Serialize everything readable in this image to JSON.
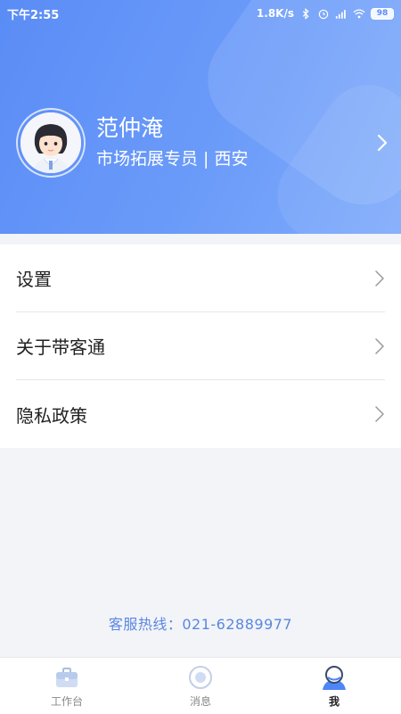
{
  "status_bar": {
    "time": "下午2:55",
    "network_speed": "1.8K/s",
    "battery": "98"
  },
  "profile": {
    "name": "范仲淹",
    "role_location": "市场拓展专员 | 西安"
  },
  "menu": {
    "items": [
      {
        "label": "设置"
      },
      {
        "label": "关于带客通"
      },
      {
        "label": "隐私政策"
      }
    ]
  },
  "footer": {
    "hotline": "客服热线：021-62889977"
  },
  "tabbar": {
    "tabs": [
      {
        "label": "工作台",
        "icon": "briefcase-icon",
        "active": false
      },
      {
        "label": "消息",
        "icon": "message-icon",
        "active": false
      },
      {
        "label": "我",
        "icon": "profile-icon",
        "active": true
      }
    ]
  },
  "colors": {
    "header_gradient_start": "#5a8cf6",
    "header_gradient_end": "#7fabfb",
    "accent": "#4f86f7",
    "hotline": "#5b87df"
  }
}
